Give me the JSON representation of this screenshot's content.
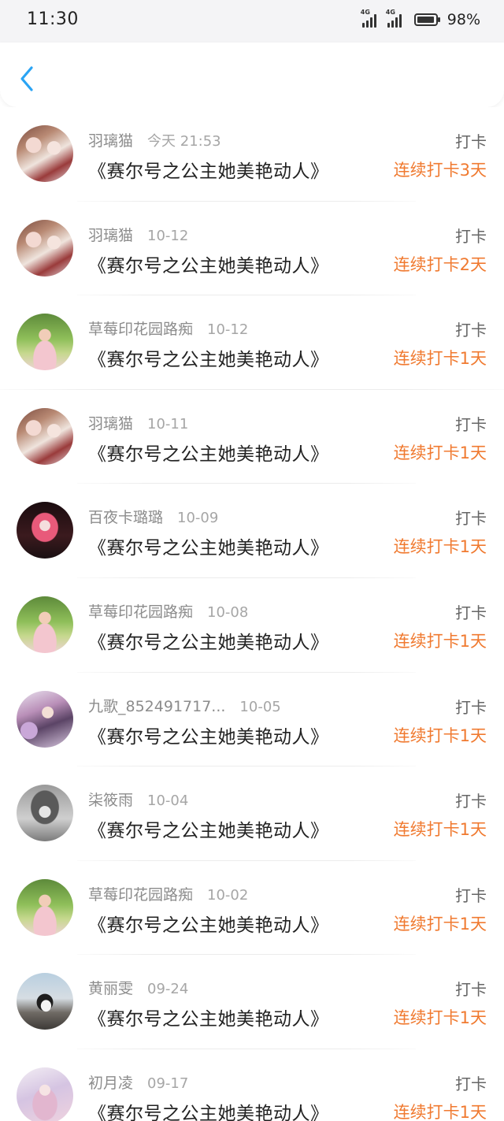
{
  "status_bar": {
    "time": "11:30",
    "network1": "4G",
    "network2": "4G",
    "battery_level": 0.98,
    "battery_text": "98%"
  },
  "nav": {
    "back_icon": "chevron-left-icon",
    "accent_color": "#2aa4f4"
  },
  "colors": {
    "streak": "#f07a30",
    "name": "#8c8c8c",
    "title": "#222222"
  },
  "items": [
    {
      "name": "羽璃猫",
      "date": "今天 21:53",
      "title": "《赛尔号之公主她美艳动人》",
      "label": "打卡",
      "streak": "连续打卡3天",
      "avatar": "anime-girls-umbrella"
    },
    {
      "name": "羽璃猫",
      "date": "10-12",
      "title": "《赛尔号之公主她美艳动人》",
      "label": "打卡",
      "streak": "连续打卡2天",
      "avatar": "anime-girls-umbrella"
    },
    {
      "name": "草莓印花园路痴",
      "date": "10-12",
      "title": "《赛尔号之公主她美艳动人》",
      "label": "打卡",
      "streak": "连续打卡1天",
      "avatar": "girl-in-garden"
    },
    {
      "name": "羽璃猫",
      "date": "10-11",
      "title": "《赛尔号之公主她美艳动人》",
      "label": "打卡",
      "streak": "连续打卡1天",
      "avatar": "anime-girls-umbrella"
    },
    {
      "name": "百夜卡璐璐",
      "date": "10-09",
      "title": "《赛尔号之公主她美艳动人》",
      "label": "打卡",
      "streak": "连续打卡1天",
      "avatar": "pink-hair-anime"
    },
    {
      "name": "草莓印花园路痴",
      "date": "10-08",
      "title": "《赛尔号之公主她美艳动人》",
      "label": "打卡",
      "streak": "连续打卡1天",
      "avatar": "girl-in-garden"
    },
    {
      "name": "九歌_852491717...",
      "date": "10-05",
      "title": "《赛尔号之公主她美艳动人》",
      "label": "打卡",
      "streak": "连续打卡1天",
      "avatar": "anime-girl-flowers"
    },
    {
      "name": "柒筱雨",
      "date": "10-04",
      "title": "《赛尔号之公主她美艳动人》",
      "label": "打卡",
      "streak": "连续打卡1天",
      "avatar": "monochrome-anime"
    },
    {
      "name": "草莓印花园路痴",
      "date": "10-02",
      "title": "《赛尔号之公主她美艳动人》",
      "label": "打卡",
      "streak": "连续打卡1天",
      "avatar": "girl-in-garden"
    },
    {
      "name": "黄丽雯",
      "date": "09-24",
      "title": "《赛尔号之公主她美艳动人》",
      "label": "打卡",
      "streak": "连续打卡1天",
      "avatar": "penguin"
    },
    {
      "name": "初月凌",
      "date": "09-17",
      "title": "《赛尔号之公主她美艳动人》",
      "label": "打卡",
      "streak": "连续打卡1天",
      "avatar": "anime-girl-pastel"
    }
  ]
}
